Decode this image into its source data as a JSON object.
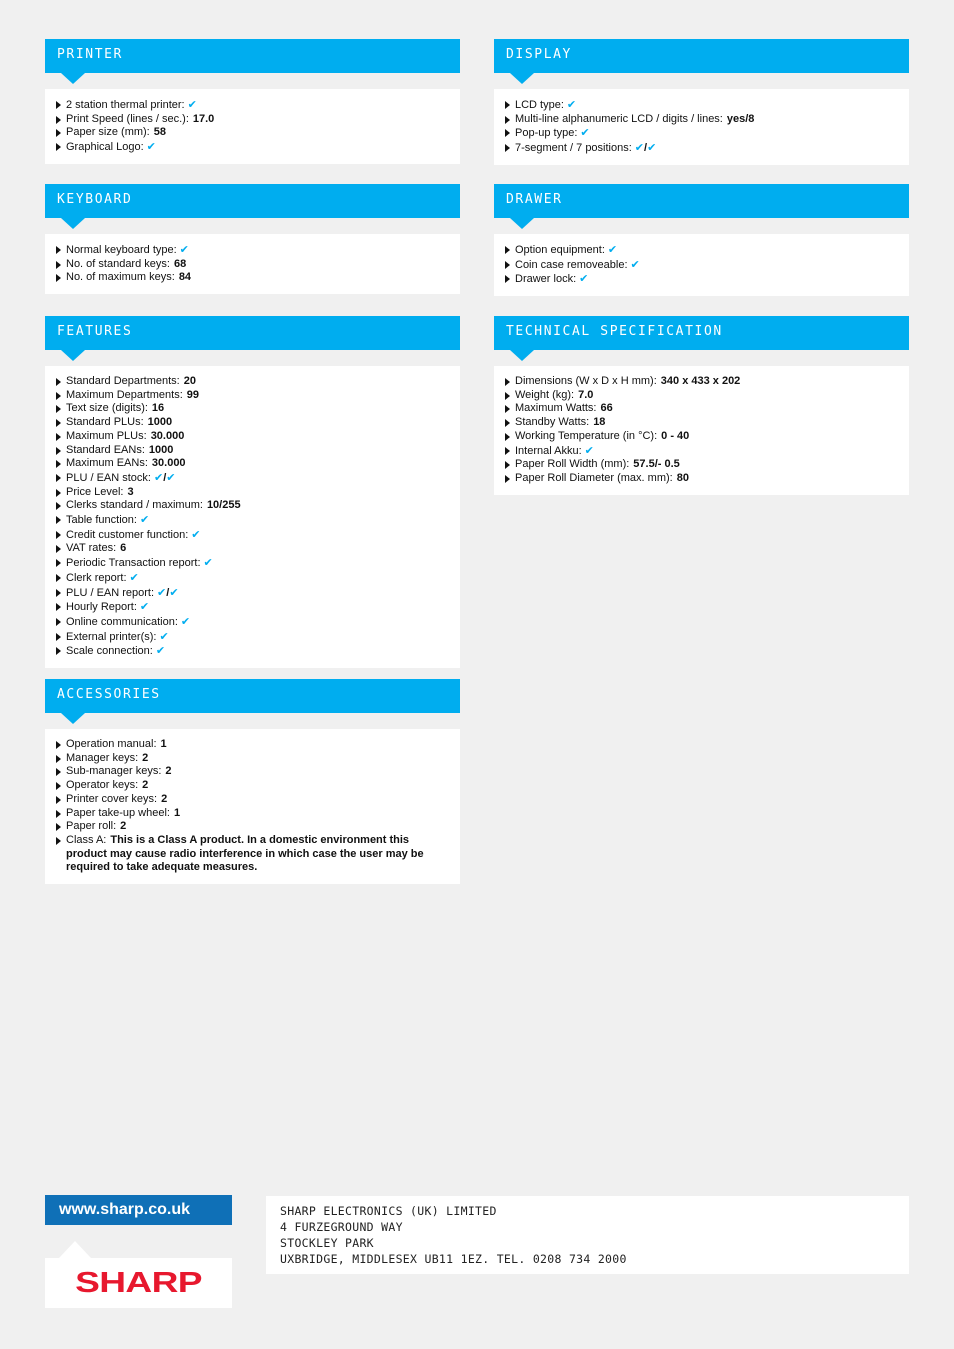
{
  "colors": {
    "accent": "#00adef",
    "url_bar": "#0f70b7",
    "logo_red": "#e7182e",
    "background": "#f0f0f0"
  },
  "sections": {
    "printer": {
      "title": "PRINTER",
      "items": [
        {
          "label": "2 station thermal printer:",
          "check": "✔"
        },
        {
          "label": "Print Speed (lines / sec.):",
          "value": "17.0"
        },
        {
          "label": "Paper size (mm):",
          "value": "58"
        },
        {
          "label": "Graphical Logo:",
          "check": "✔"
        }
      ]
    },
    "display": {
      "title": "DISPLAY",
      "items": [
        {
          "label": "LCD type:",
          "check": "✔"
        },
        {
          "label": "Multi-line alphanumeric LCD / digits / lines:",
          "value": "yes/8"
        },
        {
          "label": "Pop-up type:",
          "check": "✔"
        },
        {
          "label": "7-segment / 7 positions:",
          "check": "✔",
          "check2": "✔",
          "slash": "/"
        }
      ]
    },
    "keyboard": {
      "title": "KEYBOARD",
      "items": [
        {
          "label": "Normal keyboard type:",
          "check": "✔"
        },
        {
          "label": "No. of standard keys:",
          "value": "68"
        },
        {
          "label": "No. of maximum keys:",
          "value": "84"
        }
      ]
    },
    "drawer": {
      "title": "DRAWER",
      "items": [
        {
          "label": "Option equipment:",
          "check": "✔"
        },
        {
          "label": "Coin case removeable:",
          "check": "✔"
        },
        {
          "label": "Drawer lock:",
          "check": "✔"
        }
      ]
    },
    "features": {
      "title": "FEATURES",
      "items": [
        {
          "label": "Standard Departments:",
          "value": "20"
        },
        {
          "label": "Maximum Departments:",
          "value": "99"
        },
        {
          "label": "Text size (digits):",
          "value": "16"
        },
        {
          "label": "Standard PLUs:",
          "value": "1000"
        },
        {
          "label": "Maximum PLUs:",
          "value": "30.000"
        },
        {
          "label": "Standard EANs:",
          "value": "1000"
        },
        {
          "label": "Maximum EANs:",
          "value": "30.000"
        },
        {
          "label": "PLU / EAN stock:",
          "check": "✔",
          "check2": "✔",
          "slash": "/"
        },
        {
          "label": "Price Level:",
          "value": "3"
        },
        {
          "label": "Clerks standard / maximum:",
          "value": "10/255"
        },
        {
          "label": "Table function:",
          "check": "✔"
        },
        {
          "label": "Credit customer function:",
          "check": "✔"
        },
        {
          "label": "VAT rates:",
          "value": "6"
        },
        {
          "label": "Periodic Transaction report:",
          "check": "✔"
        },
        {
          "label": "Clerk report:",
          "check": "✔"
        },
        {
          "label": "PLU / EAN report:",
          "check": "✔",
          "check2": "✔",
          "slash": "/"
        },
        {
          "label": "Hourly Report:",
          "check": "✔"
        },
        {
          "label": "Online communication:",
          "check": "✔"
        },
        {
          "label": "External printer(s):",
          "check": "✔"
        },
        {
          "label": "Scale connection:",
          "check": "✔"
        }
      ]
    },
    "technical": {
      "title": "TECHNICAL SPECIFICATION",
      "items": [
        {
          "label": "Dimensions (W x D x H mm):",
          "value": "340 x 433 x 202"
        },
        {
          "label": "Weight (kg):",
          "value": "7.0"
        },
        {
          "label": "Maximum Watts:",
          "value": "66"
        },
        {
          "label": "Standby Watts:",
          "value": "18"
        },
        {
          "label": "Working Temperature (in °C):",
          "value": "0 - 40"
        },
        {
          "label": "Internal Akku:",
          "check": "✔"
        },
        {
          "label": "Paper Roll Width (mm):",
          "value": "57.5/- 0.5"
        },
        {
          "label": "Paper Roll Diameter (max. mm):",
          "value": "80"
        }
      ]
    },
    "accessories": {
      "title": "ACCESSORIES",
      "items": [
        {
          "label": "Operation manual:",
          "value": "1"
        },
        {
          "label": "Manager keys:",
          "value": "2"
        },
        {
          "label": "Sub-manager keys:",
          "value": "2"
        },
        {
          "label": "Operator keys:",
          "value": "2"
        },
        {
          "label": "Printer cover keys:",
          "value": "2"
        },
        {
          "label": "Paper take-up wheel:",
          "value": "1"
        },
        {
          "label": "Paper roll:",
          "value": "2"
        },
        {
          "label": "Class A:",
          "value": "This is a Class A product. In a domestic environment this product may cause radio interference in which case the user may be required to take adequate measures."
        }
      ]
    }
  },
  "footer": {
    "url": "www.sharp.co.uk",
    "logo": "SHARP",
    "address": [
      "SHARP ELECTRONICS (UK) LIMITED",
      "4 FURZEGROUND WAY",
      "STOCKLEY PARK",
      "UXBRIDGE, MIDDLESEX UB11 1EZ. TEL. 0208 734 2000"
    ]
  }
}
